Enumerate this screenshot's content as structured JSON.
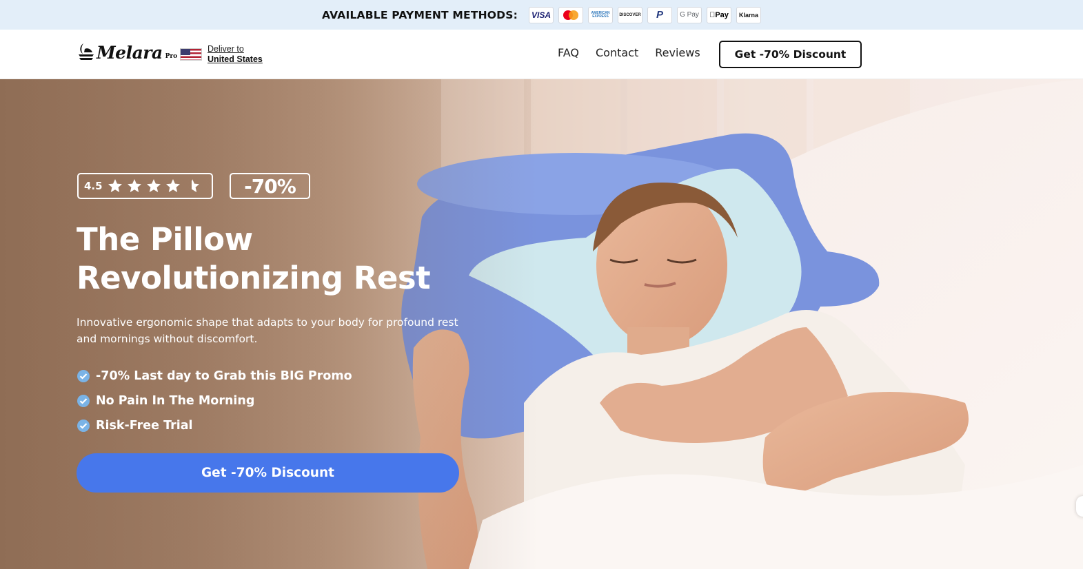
{
  "paybar": {
    "title": "AVAILABLE PAYMENT METHODS:",
    "methods": [
      {
        "name": "visa-icon",
        "label": "VISA"
      },
      {
        "name": "mastercard-icon",
        "label": ""
      },
      {
        "name": "amex-icon",
        "label": "AMERICAN EXPRESS"
      },
      {
        "name": "discover-icon",
        "label": "DISCOVER"
      },
      {
        "name": "paypal-icon",
        "label": "P"
      },
      {
        "name": "google-pay-icon",
        "label": "G Pay"
      },
      {
        "name": "apple-pay-icon",
        "label": "Pay"
      },
      {
        "name": "klarna-icon",
        "label": "Klarna"
      }
    ]
  },
  "header": {
    "logo_text": "Melara",
    "logo_sub": "Pro",
    "deliver_label": "Deliver to",
    "deliver_country": "United States",
    "nav": [
      "FAQ",
      "Contact",
      "Reviews"
    ],
    "cta_label": "Get -70% Discount"
  },
  "hero": {
    "rating": "4.5",
    "rating_value": 4.5,
    "rating_max": 5,
    "discount_badge": "-70%",
    "title_line1": "The Pillow",
    "title_line2": "Revolutionizing Rest",
    "description": "Innovative ergonomic shape that adapts to your body for profound rest and mornings without discomfort.",
    "features": [
      "-70% Last day to Grab this BIG Promo",
      "No Pain In The Morning",
      "Risk-Free Trial"
    ],
    "cta_label": "Get -70% Discount"
  },
  "colors": {
    "paybar_bg": "#e3eef9",
    "cta_blue": "#4777eb",
    "check_blue": "#7ab3e6",
    "pillow_blue": "#7a93dd",
    "pillow_light": "#cfe8ee"
  }
}
